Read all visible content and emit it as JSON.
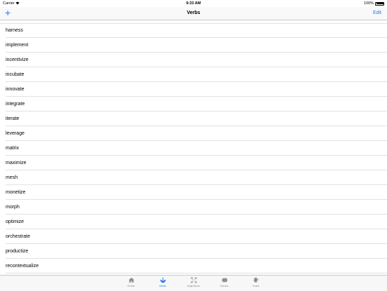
{
  "status": {
    "carrier": "Carrier",
    "time": "9:33 AM",
    "battery": "100%"
  },
  "nav": {
    "add_glyph": "+",
    "title": "Verbs",
    "edit_label": "Edit"
  },
  "verbs": [
    "harness",
    "implement",
    "incentivize",
    "incubate",
    "innovate",
    "integrate",
    "iterate",
    "leverage",
    "matrix",
    "maximize",
    "mesh",
    "monetize",
    "morph",
    "optimize",
    "orchestrate",
    "productize",
    "recontextualize"
  ],
  "tabs": [
    {
      "label": "Home",
      "icon": "home-icon",
      "active": false
    },
    {
      "label": "Verbs",
      "icon": "verbs-icon",
      "active": true
    },
    {
      "label": "Adjectives",
      "icon": "expand-icon",
      "active": false
    },
    {
      "label": "Nouns",
      "icon": "nouns-icon",
      "active": false
    },
    {
      "label": "Voice",
      "icon": "voice-icon",
      "active": false
    }
  ],
  "colors": {
    "accent": "#1a7cf2",
    "inactive": "#8e8e93"
  }
}
